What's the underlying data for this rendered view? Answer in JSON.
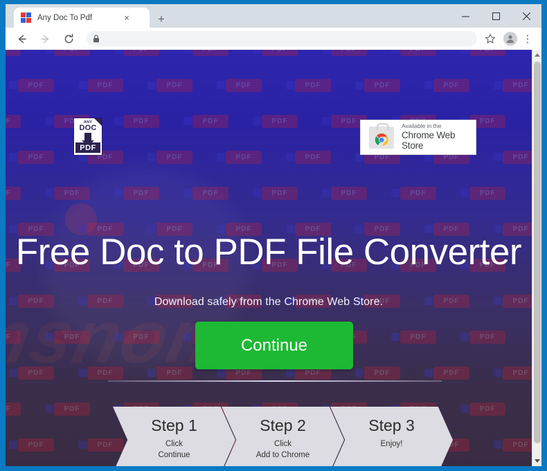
{
  "browser": {
    "tab": {
      "title": "Any Doc To Pdf",
      "favicon": "document-favicon",
      "close_label": "×"
    },
    "new_tab_label": "+",
    "window_controls": {
      "minimize": "–",
      "maximize": "□",
      "close": "×"
    },
    "toolbar": {
      "back": "←",
      "forward": "→",
      "reload": "⟳",
      "lock": "lock-icon",
      "url_value": "",
      "url_placeholder": "",
      "bookmark": "☆",
      "profile": "profile-avatar",
      "menu": "⋮"
    },
    "scrollbar": {
      "up_arrow": "▲",
      "down_arrow": "▼"
    }
  },
  "page": {
    "logo": {
      "top_label": "ANY",
      "mid_label": "DOC",
      "bottom_label": "PDF"
    },
    "chrome_web_store_badge": {
      "line1": "Available in the",
      "line2": "Chrome Web Store"
    },
    "hero": {
      "title": "Free Doc to PDF File Converter",
      "subtitle": "Download safely from the Chrome Web Store."
    },
    "cta": {
      "label": "Continue"
    },
    "steps": [
      {
        "title": "Step 1",
        "line1": "Click",
        "line2": "Continue"
      },
      {
        "title": "Step 2",
        "line1": "Click",
        "line2": "Add to Chrome"
      },
      {
        "title": "Step 3",
        "line1": "Enjoy!",
        "line2": ""
      }
    ],
    "watermark_text": "nsnom",
    "tile_text": "PDF"
  },
  "colors": {
    "window_frame": "#0b7ac2",
    "bg_top": "#2d26ad",
    "bg_bottom": "#392c42",
    "cta_green": "#1db934",
    "step_fill": "#dcdce2"
  }
}
